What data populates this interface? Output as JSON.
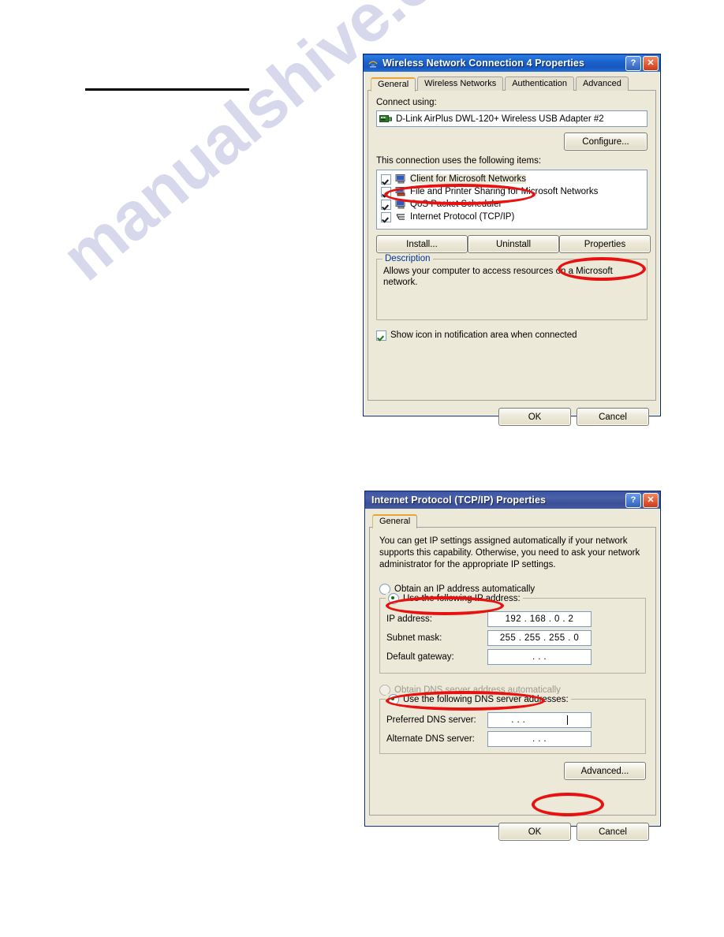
{
  "watermark": {
    "text": "manualshive.com"
  },
  "dialog1": {
    "title": "Wireless Network Connection 4 Properties",
    "title_icon": "wireless-network-icon",
    "help_button": "?",
    "close_button": "✕",
    "tabs": [
      {
        "label": "General",
        "active": true
      },
      {
        "label": "Wireless Networks",
        "active": false
      },
      {
        "label": "Authentication",
        "active": false
      },
      {
        "label": "Advanced",
        "active": false
      }
    ],
    "connect_using_label": "Connect using:",
    "adapter_name": "D-Link AirPlus DWL-120+ Wireless USB Adapter #2",
    "configure_button": "Configure...",
    "items_label": "This connection uses the following items:",
    "items": [
      {
        "label": "Client for Microsoft Networks",
        "checked": true,
        "selected": true,
        "icon": "computer-icon"
      },
      {
        "label": "File and Printer Sharing for Microsoft Networks",
        "checked": true,
        "selected": false,
        "icon": "printer-share-icon"
      },
      {
        "label": "QoS Packet Scheduler",
        "checked": true,
        "selected": false,
        "icon": "computer-icon"
      },
      {
        "label": "Internet Protocol (TCP/IP)",
        "checked": true,
        "selected": false,
        "icon": "protocol-icon"
      }
    ],
    "install_button": "Install...",
    "uninstall_button": "Uninstall",
    "properties_button": "Properties",
    "description_title": "Description",
    "description_text": "Allows your computer to access resources on a Microsoft network.",
    "show_icon_checkbox": {
      "label": "Show icon in notification area when connected",
      "checked": true
    },
    "ok_button": "OK",
    "cancel_button": "Cancel"
  },
  "dialog2": {
    "title": "Internet Protocol (TCP/IP) Properties",
    "help_button": "?",
    "close_button": "✕",
    "tabs": [
      {
        "label": "General",
        "active": true
      }
    ],
    "intro_text": "You can get IP settings assigned automatically if your network supports this capability. Otherwise, you need to ask your network administrator for the appropriate IP settings.",
    "ip_mode": {
      "auto_label": "Obtain an IP address automatically",
      "manual_label": "Use the following IP address:",
      "selected": "manual"
    },
    "ip_address_label": "IP address:",
    "ip_address_value": "192 . 168 .  0  .  2",
    "subnet_mask_label": "Subnet mask:",
    "subnet_mask_value": "255 . 255 . 255 .  0",
    "default_gateway_label": "Default gateway:",
    "default_gateway_value": ".      .      .",
    "dns_mode": {
      "auto_label": "Obtain DNS server address automatically",
      "manual_label": "Use the following DNS server addresses:",
      "selected": "manual"
    },
    "preferred_dns_label": "Preferred DNS server:",
    "preferred_dns_value": ".      .      .",
    "alternate_dns_label": "Alternate DNS server:",
    "alternate_dns_value": ".      .      .",
    "advanced_button": "Advanced...",
    "ok_button": "OK",
    "cancel_button": "Cancel"
  },
  "highlights": {
    "color": "#e8110f",
    "items": [
      "client-for-microsoft-networks-row",
      "properties-button",
      "use-following-ip-address-radio",
      "use-following-dns-radio",
      "tcpip-ok-button"
    ]
  }
}
